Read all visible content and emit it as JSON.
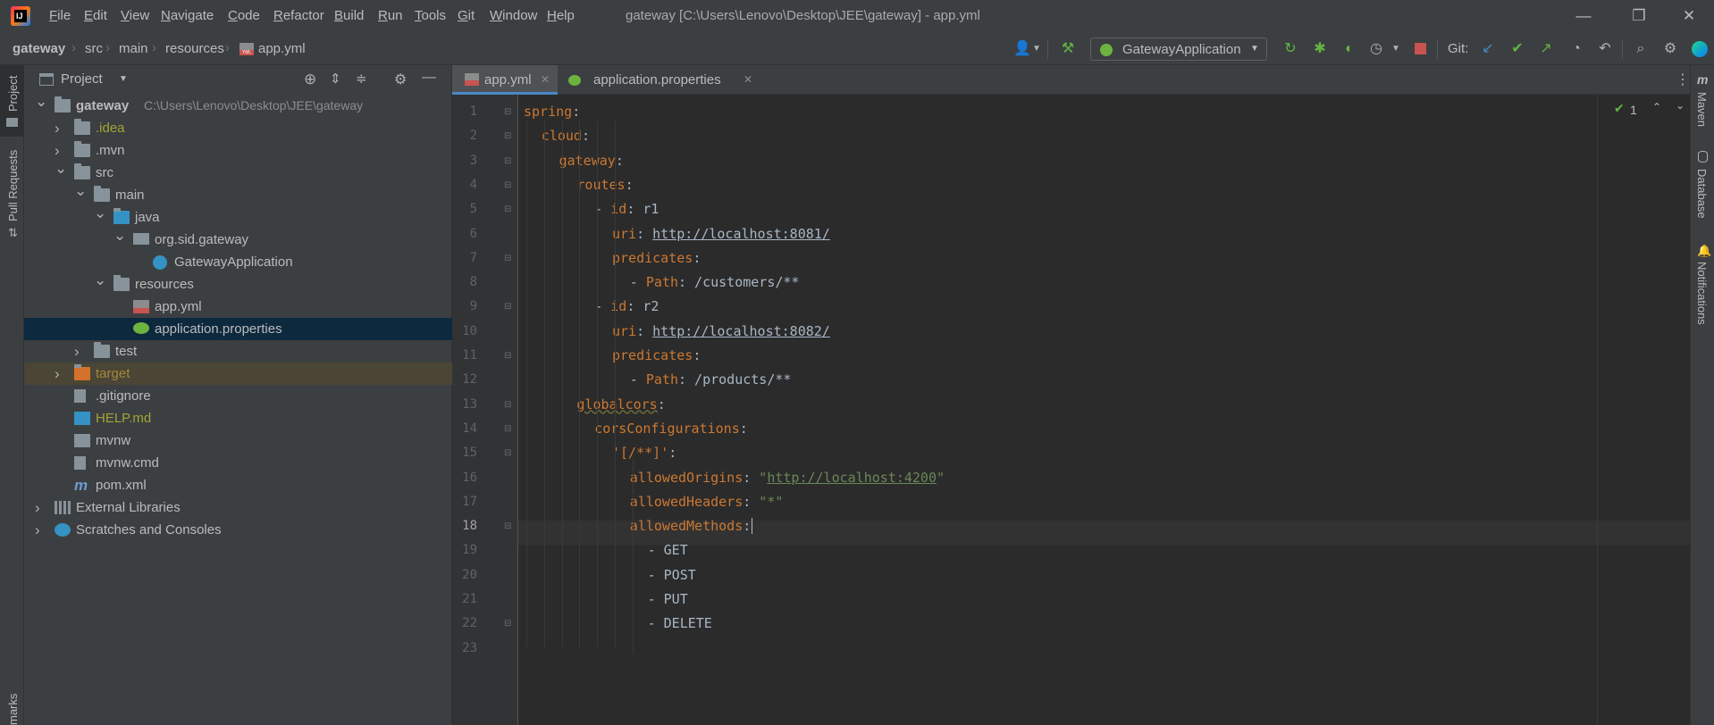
{
  "menu": [
    "File",
    "Edit",
    "View",
    "Navigate",
    "Code",
    "Refactor",
    "Build",
    "Run",
    "Tools",
    "Git",
    "Window",
    "Help"
  ],
  "window_title": "gateway [C:\\Users\\Lenovo\\Desktop\\JEE\\gateway] - app.yml",
  "breadcrumb": [
    "gateway",
    "src",
    "main",
    "resources",
    "app.yml"
  ],
  "run_config": "GatewayApplication",
  "git_label": "Git:",
  "left_strip": {
    "project": "Project",
    "pull_requests": "Pull Requests",
    "bookmarks": "marks"
  },
  "right_strip": {
    "maven": "Maven",
    "database": "Database",
    "notifications": "Notifications"
  },
  "project_panel": {
    "title": "Project",
    "root_path": "C:\\Users\\Lenovo\\Desktop\\JEE\\gateway",
    "tree": [
      {
        "label": "gateway",
        "depth": 0,
        "arrow": "▼",
        "icon": "folder",
        "color": "#bbbbbb"
      },
      {
        "label": ".idea",
        "depth": 1,
        "arrow": "▶",
        "icon": "folder",
        "color": "#a3a334"
      },
      {
        "label": ".mvn",
        "depth": 1,
        "arrow": "▶",
        "icon": "folder",
        "color": "#bbbbbb"
      },
      {
        "label": "src",
        "depth": 1,
        "arrow": "▼",
        "icon": "folder",
        "color": "#bbbbbb"
      },
      {
        "label": "main",
        "depth": 2,
        "arrow": "▼",
        "icon": "folder",
        "color": "#bbbbbb"
      },
      {
        "label": "java",
        "depth": 3,
        "arrow": "▼",
        "icon": "folder-blue",
        "color": "#bbbbbb"
      },
      {
        "label": "org.sid.gateway",
        "depth": 4,
        "arrow": "▼",
        "icon": "package",
        "color": "#bbbbbb"
      },
      {
        "label": "GatewayApplication",
        "depth": 5,
        "arrow": "",
        "icon": "spring-class",
        "color": "#bbbbbb"
      },
      {
        "label": "resources",
        "depth": 3,
        "arrow": "▼",
        "icon": "folder-res",
        "color": "#bbbbbb"
      },
      {
        "label": "app.yml",
        "depth": 4,
        "arrow": "",
        "icon": "yml",
        "color": "#bbbbbb"
      },
      {
        "label": "application.properties",
        "depth": 4,
        "arrow": "",
        "icon": "spring-props",
        "color": "#bbbbbb"
      },
      {
        "label": "test",
        "depth": 2,
        "arrow": "▶",
        "icon": "folder",
        "color": "#bbbbbb"
      },
      {
        "label": "target",
        "depth": 1,
        "arrow": "▶",
        "icon": "folder-orange",
        "color": "#a58a3b"
      },
      {
        "label": ".gitignore",
        "depth": 1,
        "arrow": "",
        "icon": "file",
        "color": "#bbbbbb"
      },
      {
        "label": "HELP.md",
        "depth": 1,
        "arrow": "",
        "icon": "md",
        "color": "#a3a334"
      },
      {
        "label": "mvnw",
        "depth": 1,
        "arrow": "",
        "icon": "terminal",
        "color": "#bbbbbb"
      },
      {
        "label": "mvnw.cmd",
        "depth": 1,
        "arrow": "",
        "icon": "file",
        "color": "#bbbbbb"
      },
      {
        "label": "pom.xml",
        "depth": 1,
        "arrow": "",
        "icon": "maven",
        "color": "#bbbbbb"
      },
      {
        "label": "External Libraries",
        "depth": 0,
        "arrow": "▶",
        "icon": "libraries",
        "color": "#bbbbbb"
      },
      {
        "label": "Scratches and Consoles",
        "depth": 0,
        "arrow": "▶",
        "icon": "scratches",
        "color": "#bbbbbb"
      }
    ]
  },
  "editor": {
    "tabs": [
      {
        "label": "app.yml",
        "active": true
      },
      {
        "label": "application.properties",
        "active": false
      }
    ],
    "inspection_count": "1",
    "current_line": 18,
    "lines": [
      {
        "n": "1",
        "indent": 0,
        "parts": [
          [
            "k",
            "spring"
          ],
          [
            "p",
            ":"
          ]
        ]
      },
      {
        "n": "2",
        "indent": 1,
        "parts": [
          [
            "k",
            "cloud"
          ],
          [
            "p",
            ":"
          ]
        ]
      },
      {
        "n": "3",
        "indent": 2,
        "parts": [
          [
            "k",
            "gateway"
          ],
          [
            "p",
            ":"
          ]
        ]
      },
      {
        "n": "4",
        "indent": 3,
        "parts": [
          [
            "k",
            "routes"
          ],
          [
            "p",
            ":"
          ]
        ]
      },
      {
        "n": "5",
        "indent": 4,
        "parts": [
          [
            "p",
            "- "
          ],
          [
            "k",
            "id"
          ],
          [
            "p",
            ": r1"
          ]
        ]
      },
      {
        "n": "6",
        "indent": 5,
        "parts": [
          [
            "k",
            "uri"
          ],
          [
            "p",
            ": "
          ],
          [
            "u",
            "http://localhost:8081/"
          ]
        ]
      },
      {
        "n": "7",
        "indent": 5,
        "parts": [
          [
            "k",
            "predicates"
          ],
          [
            "p",
            ":"
          ]
        ]
      },
      {
        "n": "8",
        "indent": 6,
        "parts": [
          [
            "p",
            "- "
          ],
          [
            "k",
            "Path"
          ],
          [
            "p",
            ": /customers/**"
          ]
        ]
      },
      {
        "n": "9",
        "indent": 4,
        "parts": [
          [
            "p",
            "- "
          ],
          [
            "k",
            "id"
          ],
          [
            "p",
            ": r2"
          ]
        ]
      },
      {
        "n": "10",
        "indent": 5,
        "parts": [
          [
            "k",
            "uri"
          ],
          [
            "p",
            ": "
          ],
          [
            "u",
            "http://localhost:8082/"
          ]
        ]
      },
      {
        "n": "11",
        "indent": 5,
        "parts": [
          [
            "k",
            "predicates"
          ],
          [
            "p",
            ":"
          ]
        ]
      },
      {
        "n": "12",
        "indent": 6,
        "parts": [
          [
            "p",
            "- "
          ],
          [
            "k",
            "Path"
          ],
          [
            "p",
            ": /products/**"
          ]
        ]
      },
      {
        "n": "13",
        "indent": 3,
        "parts": [
          [
            "k",
            "globalcors"
          ],
          [
            "p",
            ":"
          ]
        ]
      },
      {
        "n": "14",
        "indent": 4,
        "parts": [
          [
            "k",
            "corsConfigurations"
          ],
          [
            "p",
            ":"
          ]
        ]
      },
      {
        "n": "15",
        "indent": 5,
        "parts": [
          [
            "k",
            "'[/**]'"
          ],
          [
            "p",
            ":"
          ]
        ]
      },
      {
        "n": "16",
        "indent": 6,
        "parts": [
          [
            "k",
            "allowedOrigins"
          ],
          [
            "p",
            ": "
          ],
          [
            "s",
            "\""
          ],
          [
            "su",
            "http://localhost:4200"
          ],
          [
            "s",
            "\""
          ]
        ]
      },
      {
        "n": "17",
        "indent": 6,
        "parts": [
          [
            "k",
            "allowedHeaders"
          ],
          [
            "p",
            ": "
          ],
          [
            "s",
            "\"*\""
          ]
        ]
      },
      {
        "n": "18",
        "indent": 6,
        "parts": [
          [
            "k",
            "allowedMethods"
          ],
          [
            "p",
            ":"
          ]
        ]
      },
      {
        "n": "19",
        "indent": 7,
        "parts": [
          [
            "p",
            "- GET"
          ]
        ]
      },
      {
        "n": "20",
        "indent": 7,
        "parts": [
          [
            "p",
            "- POST"
          ]
        ]
      },
      {
        "n": "21",
        "indent": 7,
        "parts": [
          [
            "p",
            "- PUT"
          ]
        ]
      },
      {
        "n": "22",
        "indent": 7,
        "parts": [
          [
            "p",
            "- DELETE"
          ]
        ]
      },
      {
        "n": "23",
        "indent": 0,
        "parts": []
      }
    ]
  },
  "colors": {
    "accent": "#4a88c7",
    "selection": "#0d293e",
    "target_row": "#4a4535",
    "keyword": "#cc7832",
    "string": "#6a8759"
  }
}
